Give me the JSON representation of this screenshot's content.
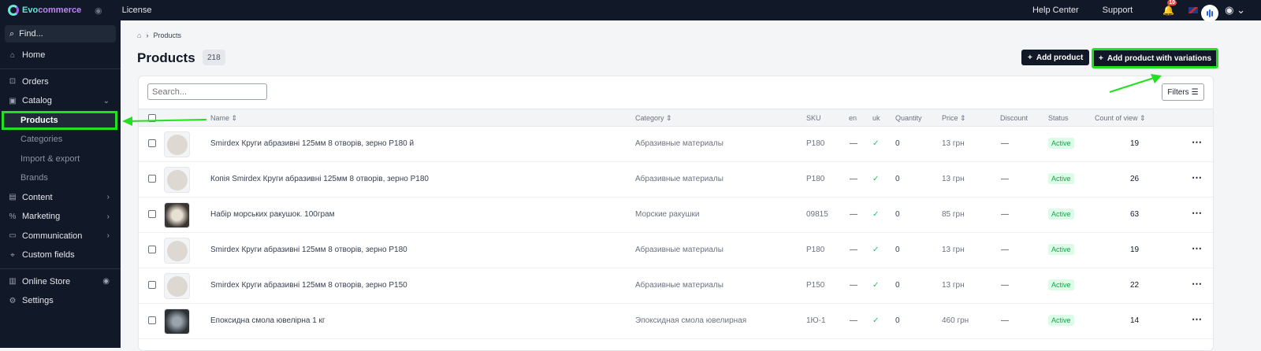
{
  "app": {
    "logo_a": "Evo",
    "logo_b": "commerce",
    "license": "License"
  },
  "top": {
    "help": "Help Center",
    "support": "Support",
    "notif_count": "10"
  },
  "sidebar": {
    "find": "Find...",
    "home": "Home",
    "orders": "Orders",
    "catalog": "Catalog",
    "sub": [
      "Products",
      "Categories",
      "Import & export",
      "Brands"
    ],
    "content": "Content",
    "marketing": "Marketing",
    "communication": "Communication",
    "custom_fields": "Custom fields",
    "online_store": "Online Store",
    "settings": "Settings"
  },
  "main": {
    "breadcrumb": "Products",
    "title": "Products",
    "count": "218",
    "add_product": "Add product",
    "add_variations": "Add product with variations",
    "search_placeholder": "Search...",
    "filters": "Filters"
  },
  "table": {
    "headers": {
      "name": "Name",
      "category": "Category",
      "sku": "SKU",
      "en": "en",
      "uk": "uk",
      "quantity": "Quantity",
      "price": "Price",
      "discount": "Discount",
      "status": "Status",
      "views": "Count of view"
    },
    "rows": [
      {
        "name": "Smirdex Круги абразивні 125мм 8 отворів, зерно P180 й",
        "category": "Абразивные материалы",
        "sku": "P180",
        "en": "—",
        "qty": "0",
        "price": "13 грн",
        "discount": "—",
        "status": "Active",
        "views": "19"
      },
      {
        "name": "Копія Smirdex Круги абразивні 125мм 8 отворів, зерно P180",
        "category": "Абразивные материалы",
        "sku": "P180",
        "en": "—",
        "qty": "0",
        "price": "13 грн",
        "discount": "—",
        "status": "Active",
        "views": "26"
      },
      {
        "name": "Набір морських ракушок. 100грам",
        "category": "Морские ракушки",
        "sku": "09815",
        "en": "—",
        "qty": "0",
        "price": "85 грн",
        "discount": "—",
        "status": "Active",
        "views": "63"
      },
      {
        "name": "Smirdex Круги абразивні 125мм 8 отворів, зерно P180",
        "category": "Абразивные материалы",
        "sku": "P180",
        "en": "—",
        "qty": "0",
        "price": "13 грн",
        "discount": "—",
        "status": "Active",
        "views": "19"
      },
      {
        "name": "Smirdex Круги абразивні 125мм 8 отворів, зерно P150",
        "category": "Абразивные материалы",
        "sku": "P150",
        "en": "—",
        "qty": "0",
        "price": "13 грн",
        "discount": "—",
        "status": "Active",
        "views": "22"
      },
      {
        "name": "Епоксидна смола ювелірна 1 кг",
        "category": "Эпоксидная смола ювелирная",
        "sku": "1Ю-1",
        "en": "—",
        "qty": "0",
        "price": "460 грн",
        "discount": "—",
        "status": "Active",
        "views": "14"
      }
    ]
  },
  "colors": {
    "highlight": "#22e01f",
    "sidebar": "#111827",
    "active_badge": "#16a34a"
  }
}
